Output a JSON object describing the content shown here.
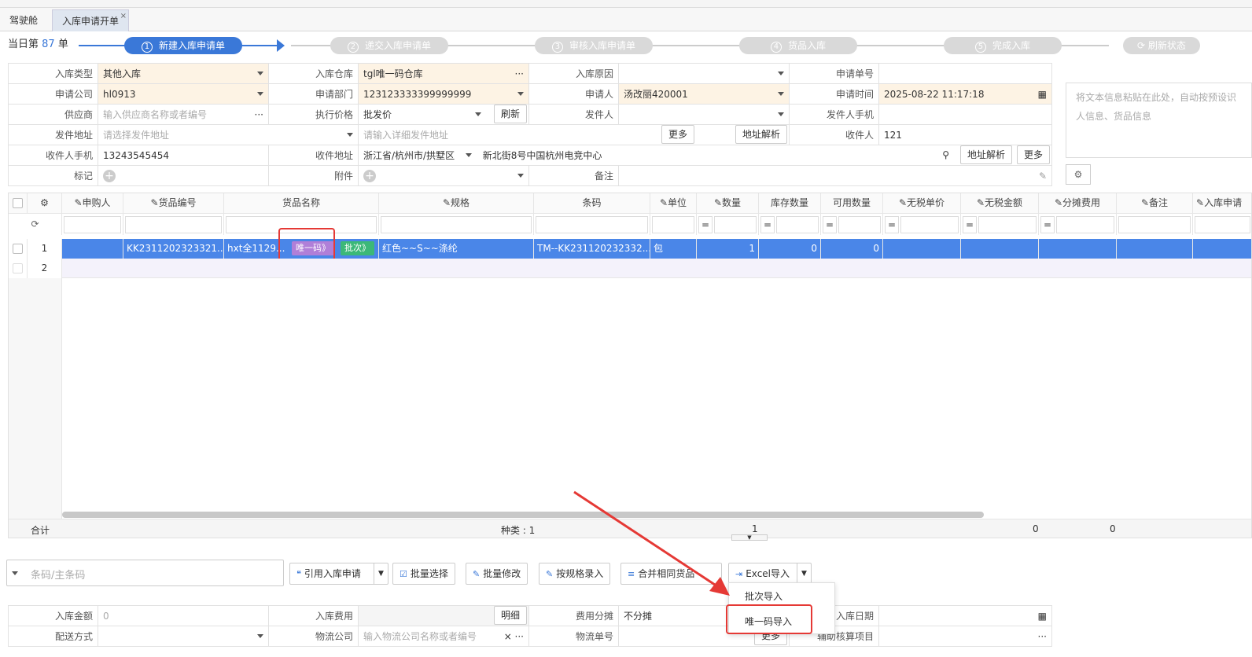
{
  "tabs": {
    "cockpit": "驾驶舱",
    "current": "入库申请开单",
    "close": "×"
  },
  "summary": {
    "prefix": "当日第",
    "count": "87",
    "suffix": "单"
  },
  "steps": [
    {
      "num": "1",
      "label": "新建入库申请单"
    },
    {
      "num": "2",
      "label": "递交入库申请单"
    },
    {
      "num": "3",
      "label": "审核入库申请单"
    },
    {
      "num": "4",
      "label": "货品入库"
    },
    {
      "num": "5",
      "label": "完成入库"
    }
  ],
  "refresh_status": "刷新状态",
  "form": {
    "type_label": "入库类型",
    "type_value": "其他入库",
    "warehouse_label": "入库仓库",
    "warehouse_value": "tgl唯一码仓库",
    "reason_label": "入库原因",
    "appno_label": "申请单号",
    "company_label": "申请公司",
    "company_value": "hl0913",
    "dept_label": "申请部门",
    "dept_value": "123123333399999999",
    "applicant_label": "申请人",
    "applicant_value": "汤改丽420001",
    "apptime_label": "申请时间",
    "apptime_value": "2025-08-22 11:17:18",
    "supplier_label": "供应商",
    "supplier_ph": "输入供应商名称或者编号",
    "price_label": "执行价格",
    "price_value": "批发价",
    "refresh_btn": "刷新",
    "sender_label": "发件人",
    "sender_phone_label": "发件人手机",
    "send_addr_label": "发件地址",
    "send_addr_ph": "请选择发件地址",
    "send_detail_ph": "请输入详细发件地址",
    "more_btn": "更多",
    "parse_btn": "地址解析",
    "receiver_label": "收件人",
    "receiver_value": "121",
    "recv_phone_label": "收件人手机",
    "recv_phone_value": "13243545454",
    "recv_addr_label": "收件地址",
    "recv_region": "浙江省/杭州市/拱墅区",
    "recv_detail": "新北街8号中国杭州电竞中心",
    "mark_label": "标记",
    "attach_label": "附件",
    "remark_label": "备注"
  },
  "paste_ph": "将文本信息粘贴在此处，自动按预设识人信息、货品信息",
  "grid": {
    "headers": [
      "申购人",
      "货品编号",
      "货品名称",
      "规格",
      "条码",
      "单位",
      "数量",
      "库存数量",
      "可用数量",
      "无税单价",
      "无税金额",
      "分摊费用",
      "备注",
      "入库申请"
    ],
    "rows": [
      {
        "no": "1",
        "code": "KK2311202323321...",
        "name": "hxt全1129...",
        "tag1": "唯一码》",
        "tag2": "批次》",
        "spec": "红色~~S~~涤纶",
        "barcode": "TM--KK231120232332...",
        "unit": "包",
        "qty": "1",
        "stock": "0",
        "avail": "0"
      },
      {
        "no": "2"
      }
    ],
    "footer_total": "合计",
    "footer_kinds": "种类 : 1",
    "footer_qty": "1",
    "footer_v1": "0",
    "footer_v2": "0"
  },
  "toolbar": {
    "barcode_ph": "条码/主条码",
    "cite": "引用入库申请",
    "batch_select": "批量选择",
    "batch_edit": "批量修改",
    "spec_entry": "按规格录入",
    "merge": "合并相同货品",
    "excel": "Excel导入"
  },
  "dropdown": {
    "batch_import": "批次导入",
    "unique_import": "唯一码导入"
  },
  "bottom": {
    "amount_label": "入库金额",
    "amount_value": "0",
    "fee_label": "入库费用",
    "detail_btn": "明细",
    "share_label": "费用分摊",
    "share_value": "不分摊",
    "date_label": "入库日期",
    "ship_label": "配送方式",
    "logistics_label": "物流公司",
    "logistics_ph": "输入物流公司名称或者编号",
    "tracking_label": "物流单号",
    "more_btn": "更多",
    "aux_label": "辅助核算项目"
  },
  "colors": {
    "accent": "#3a78d8",
    "highlight": "#e53935",
    "tag_unique": "#b07fd8",
    "tag_batch": "#3cb878"
  }
}
